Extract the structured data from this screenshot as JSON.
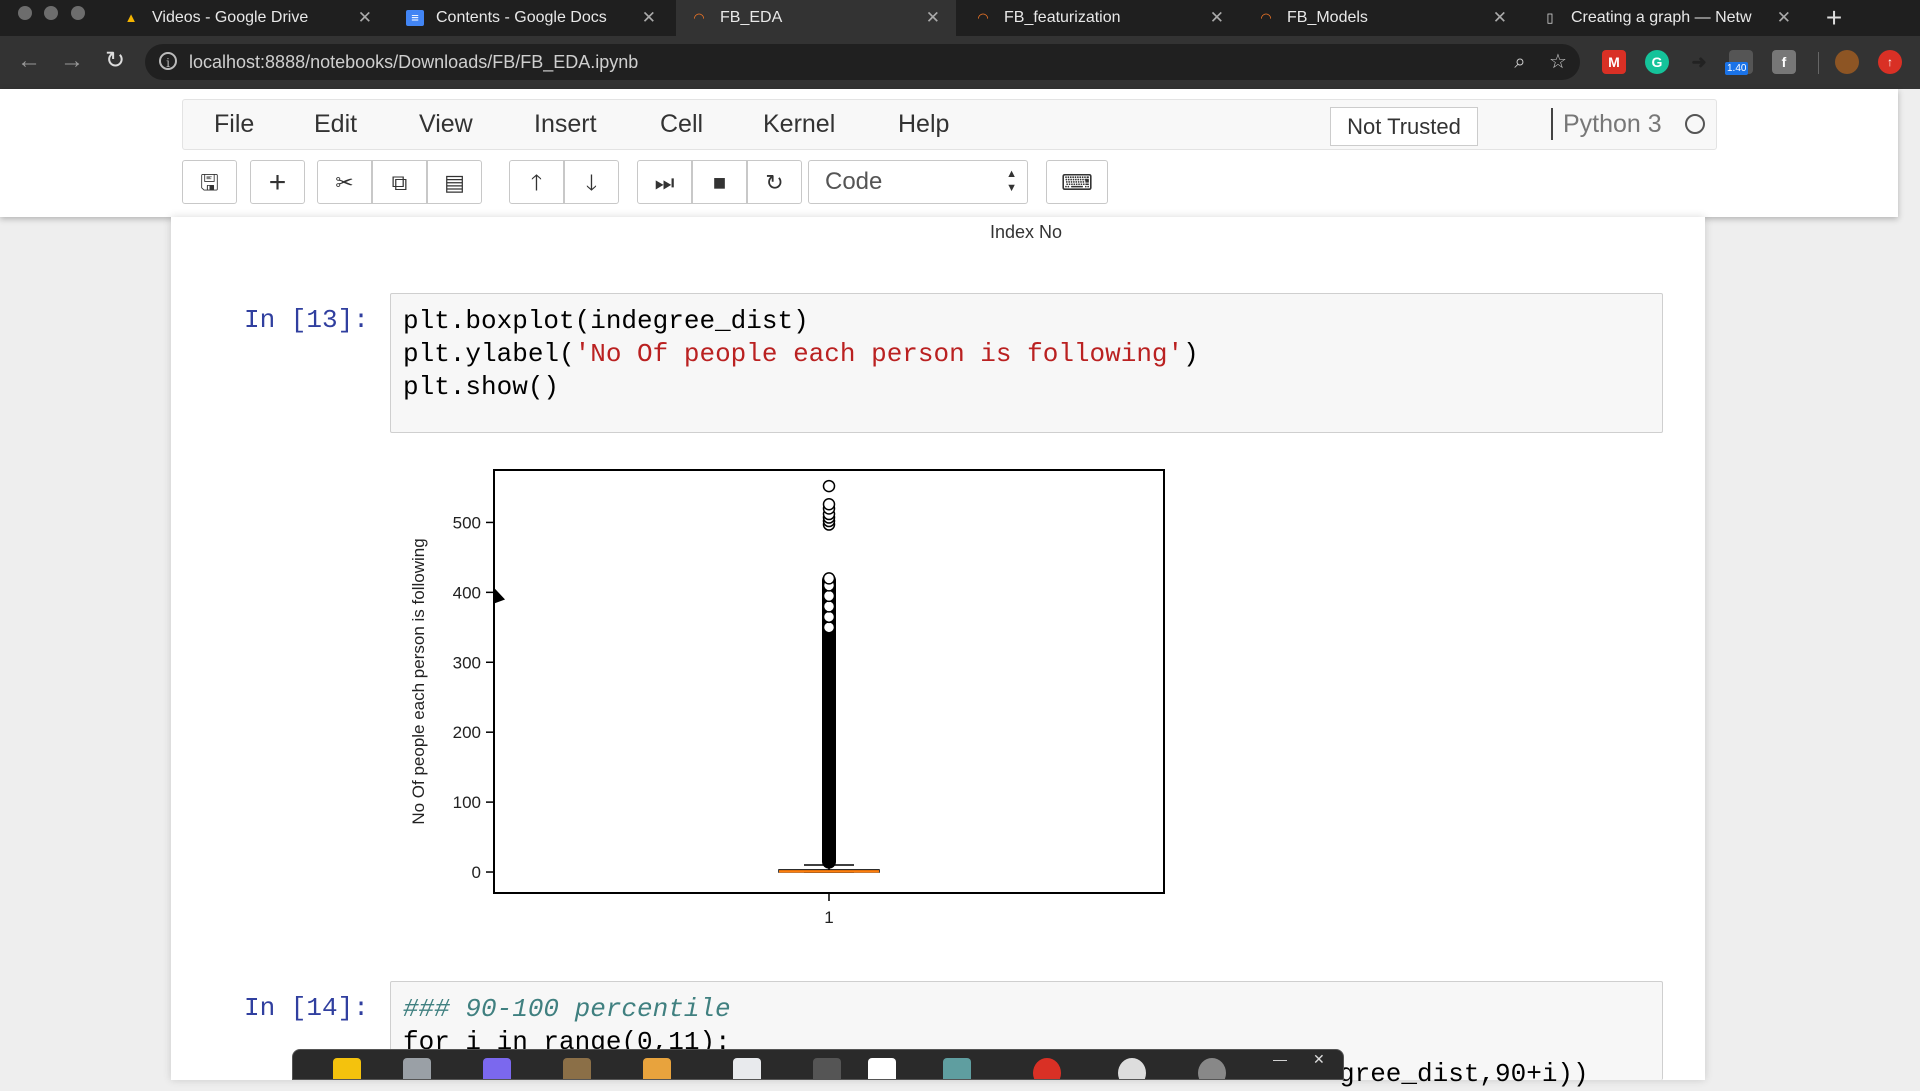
{
  "browser": {
    "tabs": [
      {
        "label": "Videos - Google Drive",
        "icon": "google-drive-icon"
      },
      {
        "label": "Contents - Google Docs",
        "icon": "google-docs-icon"
      },
      {
        "label": "FB_EDA",
        "icon": "jupyter-icon",
        "active": true
      },
      {
        "label": "FB_featurization",
        "icon": "jupyter-icon"
      },
      {
        "label": "FB_Models",
        "icon": "jupyter-icon"
      },
      {
        "label": "Creating a graph — Netw",
        "icon": "document-icon"
      }
    ],
    "url": "localhost:8888/notebooks/Downloads/FB/FB_EDA.ipynb",
    "extension_badge": "1.40"
  },
  "jupyter": {
    "menu": [
      "File",
      "Edit",
      "View",
      "Insert",
      "Cell",
      "Kernel",
      "Help"
    ],
    "trust_label": "Not Trusted",
    "kernel_name": "Python 3",
    "cell_type": "Code"
  },
  "notebook": {
    "prev_output_xlabel": "Index No",
    "cells": [
      {
        "prompt": "In [13]:",
        "lines": [
          "plt.boxplot(indegree_dist)",
          "plt.ylabel('No Of people each person is following')",
          "plt.show()"
        ]
      },
      {
        "prompt": "In [14]:",
        "lines": [
          "### 90-100 percentile",
          "for i in range(0,11):",
          "gree_dist,90+i))"
        ]
      }
    ]
  },
  "chart_data": {
    "type": "boxplot",
    "ylabel": "No Of people each person is following",
    "xlabel": "",
    "categories": [
      "1"
    ],
    "yticks": [
      0,
      100,
      200,
      300,
      400,
      500
    ],
    "ylim": [
      -30,
      575
    ],
    "series": [
      {
        "median": 1,
        "q1": 0,
        "q3": 3,
        "whisker_low": 0,
        "whisker_high": 10
      }
    ],
    "outliers_continuous_range": [
      12,
      420
    ],
    "outliers_scatter": [
      350,
      365,
      380,
      395,
      410,
      420,
      497,
      502,
      507,
      512,
      520,
      526,
      552
    ],
    "colors": {
      "median": "#ff7f0e",
      "box": "#000000"
    }
  }
}
